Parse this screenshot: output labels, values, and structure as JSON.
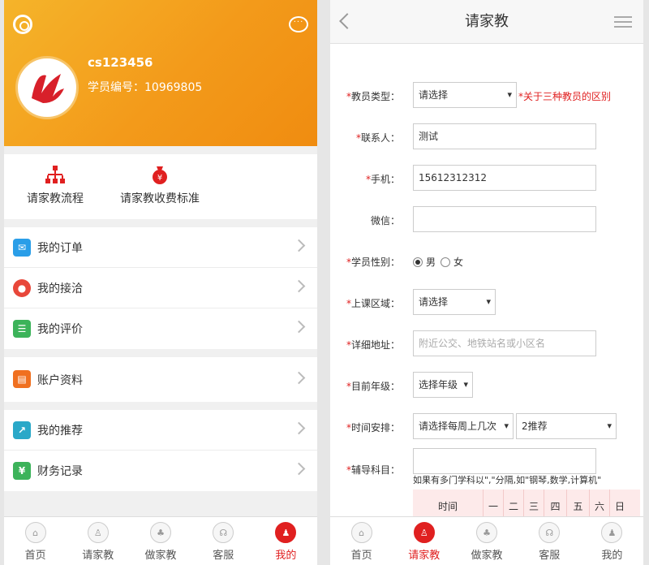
{
  "left": {
    "profile": {
      "username": "cs123456",
      "student_id": "学员编号：10969805"
    },
    "quick": [
      {
        "label": "请家教流程"
      },
      {
        "label": "请家教收费标准"
      }
    ],
    "menu_groups": [
      [
        {
          "label": "我的订单",
          "icon": "envelope-icon",
          "color": "#2a9ee8"
        },
        {
          "label": "我的接洽",
          "icon": "people-icon",
          "color": "#e8473a"
        },
        {
          "label": "我的评价",
          "icon": "id-card-icon",
          "color": "#3cb35a"
        }
      ],
      [
        {
          "label": "账户资料",
          "icon": "clipboard-icon",
          "color": "#f07020"
        }
      ],
      [
        {
          "label": "我的推荐",
          "icon": "share-icon",
          "color": "#2aa8c8"
        },
        {
          "label": "财务记录",
          "icon": "yen-icon",
          "color": "#3cb35a"
        }
      ]
    ],
    "tabs": [
      {
        "label": "首页",
        "active": false
      },
      {
        "label": "请家教",
        "active": false
      },
      {
        "label": "做家教",
        "active": false
      },
      {
        "label": "客服",
        "active": false
      },
      {
        "label": "我的",
        "active": true
      }
    ]
  },
  "right": {
    "title": "请家教",
    "fields": {
      "teacher_type": {
        "label": "教员类型：",
        "value": "请选择",
        "hint": "*关于三种教员的区别"
      },
      "contact": {
        "label": "联系人：",
        "value": "测试"
      },
      "phone": {
        "label": "手机：",
        "value": "15612312312"
      },
      "wechat": {
        "label": "微信：",
        "value": ""
      },
      "gender": {
        "label": "学员性别：",
        "options": [
          "男",
          "女"
        ],
        "selected": "男"
      },
      "area": {
        "label": "上课区域：",
        "value": "请选择"
      },
      "address": {
        "label": "详细地址：",
        "placeholder": "附近公交、地铁站名或小区名"
      },
      "grade": {
        "label": "目前年级：",
        "value": "选择年级"
      },
      "schedule": {
        "label": "时间安排：",
        "value": "请选择每周上几次",
        "value2": "2推荐"
      },
      "subject": {
        "label": "辅导科目：",
        "value": ""
      }
    },
    "subject_note": "如果有多门学科以\",\"分隔,如\"钢琴,数学,计算机\"",
    "table_headers": [
      "时间",
      "一",
      "二",
      "三",
      "四",
      "五",
      "六",
      "日"
    ],
    "tabs": [
      {
        "label": "首页",
        "active": false
      },
      {
        "label": "请家教",
        "active": true
      },
      {
        "label": "做家教",
        "active": false
      },
      {
        "label": "客服",
        "active": false
      },
      {
        "label": "我的",
        "active": false
      }
    ]
  }
}
